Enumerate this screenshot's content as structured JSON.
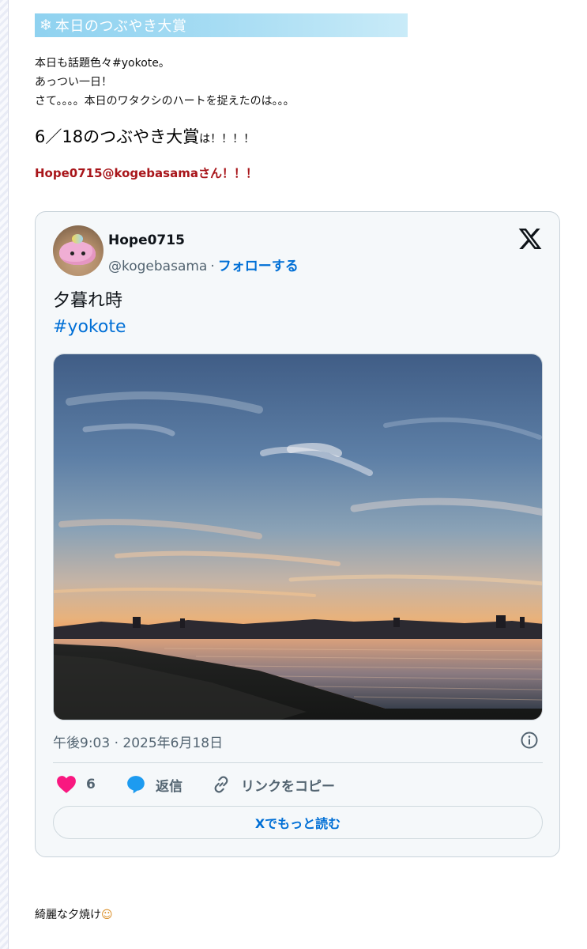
{
  "heading": {
    "icon": "snowflake-icon",
    "icon_glyph": "❄",
    "text": "本日のつぶやき大賞"
  },
  "intro": {
    "line1": "本日も話題色々#yokote。",
    "line2": "あっつい一日！",
    "line3": "さて。。。。本日のワタクシのハートを捉えたのは。。。"
  },
  "award": {
    "title": "6／18のつぶやき大賞",
    "suffix": "は！！！！"
  },
  "winner": "Hope0715@kogebasamaさん！！！",
  "tweet": {
    "display_name": "Hope0715",
    "handle": "@kogebasama",
    "dot": "·",
    "follow_label": "フォローする",
    "text": "夕暮れ時",
    "hashtag": "#yokote",
    "timestamp": "午後9:03 · 2025年6月18日",
    "likes_count": "6",
    "reply_label": "返信",
    "copy_link_label": "リンクをコピー",
    "read_more_label": "Xでもっと読む",
    "colors": {
      "like": "#f91880",
      "reply": "#1d9bf0",
      "link": "#006fd6"
    }
  },
  "caption": {
    "text": "綺麗な夕焼け",
    "emoji": "☺"
  }
}
